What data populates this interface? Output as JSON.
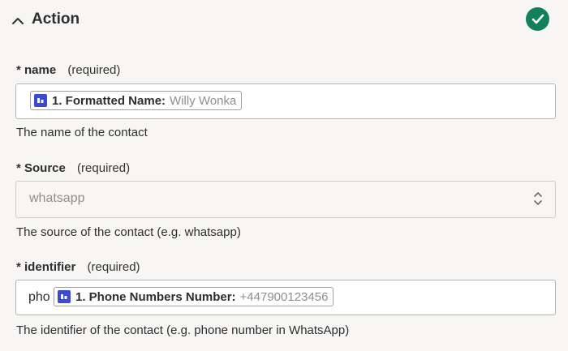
{
  "section": {
    "title": "Action",
    "collapse_icon": "chevron-up-icon",
    "status_icon": "check-circle-icon",
    "status_color": "#12805c"
  },
  "fields": {
    "name": {
      "required_marker": "*",
      "label": "name",
      "required_text": "(required)",
      "pill_label": "1. Formatted Name:",
      "pill_value": "Willy Wonka",
      "help": "The name of the contact"
    },
    "source": {
      "required_marker": "*",
      "label": "Source",
      "required_text": "(required)",
      "value": "whatsapp",
      "help": "The source of the contact (e.g. whatsapp)"
    },
    "identifier": {
      "required_marker": "*",
      "label": "identifier",
      "required_text": "(required)",
      "prefix": "pho",
      "pill_label": "1. Phone Numbers Number:",
      "pill_value": "+447900123456",
      "help": "The identifier of the contact (e.g. phone number in WhatsApp)"
    }
  },
  "colors": {
    "pill_icon": "#3b4bd1",
    "background": "#f7f6f4"
  }
}
